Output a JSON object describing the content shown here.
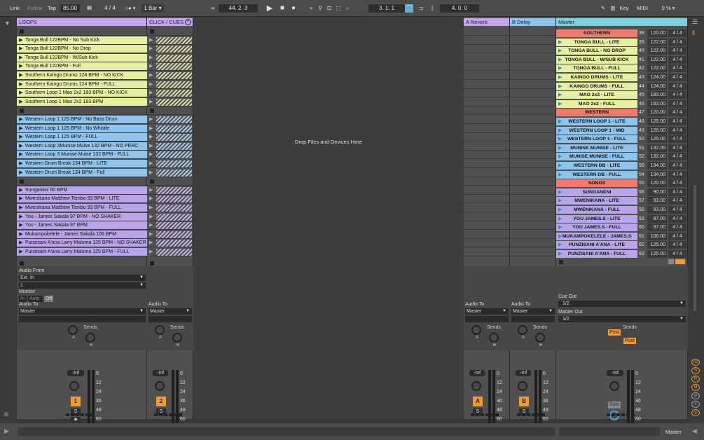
{
  "topbar": {
    "link": "Link",
    "follow": "Follow",
    "tap": "Tap",
    "tempo": "85.00",
    "signature": "4 / 4",
    "quantize": "1 Bar",
    "position": "44.  2.  3",
    "loop_start": "3.  1.  1",
    "loop_length": "4.  0.  0",
    "key": "Key",
    "midi": "MIDI",
    "cpu": "0 %"
  },
  "tracks": {
    "loops": {
      "name": "LOOPS",
      "color": "#c7a6f0",
      "clips": [
        {
          "name": "",
          "type": "stop"
        },
        {
          "name": "Tonga Bull 122BPM - No Sub Kick",
          "color": "#e6f0a0"
        },
        {
          "name": "Tonga Bull 122BPM - No Drop",
          "color": "#e6f0a0"
        },
        {
          "name": "Tonga Bull 122BPM - W/Sub Kick",
          "color": "#e6f0a0"
        },
        {
          "name": "Tonga Bull 122BPM - Full",
          "color": "#e6f0a0"
        },
        {
          "name": "Southern Kaingo Drums 124 BPM - NO KICK",
          "color": "#e6f0a0"
        },
        {
          "name": "Southern Kaingo Drums 124 BPM - FULL",
          "color": "#e6f0a0"
        },
        {
          "name": "Southern Loop 1 Mao 2x2 183 BPM - NO KICK",
          "color": "#e6f0a0"
        },
        {
          "name": "Southern Loop 1 Mao 2x2 183 BPM",
          "color": "#e6f0a0"
        },
        {
          "name": "",
          "type": "stop"
        },
        {
          "name": "Western Loop 1 125 BPM -  No Bass Drum",
          "color": "#8ec4ee"
        },
        {
          "name": "Western Loop 1 125 BPM -  No Whistle",
          "color": "#8ec4ee"
        },
        {
          "name": "Western Loop 1 125 BPM - FULL",
          "color": "#8ec4ee"
        },
        {
          "name": "Western Loop 3Munise Muise 132 BPM - NO PERC",
          "color": "#8ec4ee"
        },
        {
          "name": "Western Loop 3 Munise Muise 132 BPM - FULL",
          "color": "#8ec4ee"
        },
        {
          "name": "Western Drum Break 134 BPM - LITE",
          "color": "#8ec4ee"
        },
        {
          "name": "Western Drum Break 134 BPM - Full",
          "color": "#8ec4ee"
        },
        {
          "name": "",
          "type": "stop"
        },
        {
          "name": "Sunganeni 90 BPM",
          "color": "#b8a4ea"
        },
        {
          "name": "Mwenikana Matthew Tembo 93 BPM - LITE",
          "color": "#b8a4ea"
        },
        {
          "name": "Mwenikana Matthew Tembo 93 BPM - FULL",
          "color": "#b8a4ea"
        },
        {
          "name": "You - James Sakala 97 BPM - NO SHAKER",
          "color": "#b8a4ea"
        },
        {
          "name": "You - James Sakala 97 BPM",
          "color": "#b8a4ea"
        },
        {
          "name": "Mukampokelele - James Sakala 106 BPM",
          "color": "#b8a4ea"
        },
        {
          "name": "Punzisani A'ana Larry Maluma 125 BPM - NO SHAKER",
          "color": "#b8a4ea"
        },
        {
          "name": "Punzisani A'ana Larry Maluma 125 BPM - FULL",
          "color": "#b8a4ea"
        }
      ],
      "audio_from_label": "Audio From",
      "audio_from": "Ext. In",
      "audio_from_channel": "1",
      "monitor_label": "Monitor",
      "monitor_in": "In",
      "monitor_auto": "Auto",
      "monitor_off": "Off",
      "audio_to_label": "Audio To",
      "audio_to": "Master",
      "sends_label": "Sends",
      "volume": "-Inf",
      "number": "1",
      "solo": "S"
    },
    "click": {
      "name": "CLICK / CUES",
      "color": "#c7a6f0",
      "audio_to_label": "Audio To",
      "audio_to": "Master",
      "sends_label": "Sends",
      "volume": "-Inf",
      "number": "2",
      "solo": "S"
    },
    "reverb": {
      "name": "A Reverb",
      "color": "#c7a6f0",
      "audio_to_label": "Audio To",
      "audio_to": "Master",
      "sends_label": "Sends",
      "volume": "-Inf",
      "letter": "A",
      "solo": "S"
    },
    "delay": {
      "name": "B Delay",
      "color": "#8ec4ee",
      "audio_to_label": "Audio To",
      "audio_to": "Master",
      "sends_label": "Sends",
      "volume": "-Inf",
      "letter": "B",
      "solo": "S"
    },
    "master": {
      "name": "Master",
      "color": "#7fd0e0",
      "scenes": [
        {
          "name": "SOUTHERN",
          "num": "38",
          "bpm": "120.00",
          "sig": "4 / 4",
          "color": "#f07a6c",
          "play": false
        },
        {
          "name": "TONGA BULL - LITE",
          "num": "39",
          "bpm": "122.00",
          "sig": "4 / 4",
          "color": "#e6f0a0",
          "play": true
        },
        {
          "name": "TONGA BULL - NO DROP",
          "num": "40",
          "bpm": "122.00",
          "sig": "4 / 4",
          "color": "#e6f0a0",
          "play": true
        },
        {
          "name": "TONGA BULL - W/SUB KICK",
          "num": "41",
          "bpm": "122.00",
          "sig": "4 / 4",
          "color": "#e6f0a0",
          "play": true
        },
        {
          "name": "TONGA BULL - FULL",
          "num": "42",
          "bpm": "122.00",
          "sig": "4 / 4",
          "color": "#e6f0a0",
          "play": true
        },
        {
          "name": "KAINGO DRUMS - LITE",
          "num": "43",
          "bpm": "124.00",
          "sig": "4 / 4",
          "color": "#e6f0a0",
          "play": true
        },
        {
          "name": "KAINGO DRUMS - FULL",
          "num": "44",
          "bpm": "124.00",
          "sig": "4 / 4",
          "color": "#e6f0a0",
          "play": true
        },
        {
          "name": "MAO 2x2 - LITE",
          "num": "45",
          "bpm": "183.00",
          "sig": "4 / 4",
          "color": "#e6f0a0",
          "play": true
        },
        {
          "name": "MAO 2x2 - FULL",
          "num": "46",
          "bpm": "183.00",
          "sig": "4 / 4",
          "color": "#e6f0a0",
          "play": true
        },
        {
          "name": "WESTERN",
          "num": "47",
          "bpm": "120.00",
          "sig": "4 / 4",
          "color": "#f07a6c",
          "play": false
        },
        {
          "name": "WESTERN LOOP 1 - LITE",
          "num": "48",
          "bpm": "125.00",
          "sig": "4 / 4",
          "color": "#8ec4ee",
          "play": true
        },
        {
          "name": "WESTERN LOOP 1 - MID",
          "num": "49",
          "bpm": "125.00",
          "sig": "4 / 4",
          "color": "#8ec4ee",
          "play": true
        },
        {
          "name": "WESTERN LOOP 1 - FULL",
          "num": "50",
          "bpm": "125.00",
          "sig": "4 / 4",
          "color": "#8ec4ee",
          "play": true
        },
        {
          "name": "MUNISE MUNISE - LITE",
          "num": "51",
          "bpm": "132.00",
          "sig": "4 / 4",
          "color": "#8ec4ee",
          "play": true
        },
        {
          "name": "MUNISE MUNISE - FULL",
          "num": "52",
          "bpm": "132.00",
          "sig": "4 / 4",
          "color": "#8ec4ee",
          "play": true
        },
        {
          "name": "WESTERN DB - LITE",
          "num": "53",
          "bpm": "134.00",
          "sig": "4 / 4",
          "color": "#8ec4ee",
          "play": true
        },
        {
          "name": "WESTERN DB - FULL",
          "num": "54",
          "bpm": "134.00",
          "sig": "4 / 4",
          "color": "#8ec4ee",
          "play": true
        },
        {
          "name": "SONGS",
          "num": "55",
          "bpm": "120.00",
          "sig": "4 / 4",
          "color": "#f07a6c",
          "play": false
        },
        {
          "name": "SUNGANENI",
          "num": "56",
          "bpm": "90.00",
          "sig": "4 / 4",
          "color": "#b8a4ea",
          "play": true
        },
        {
          "name": "MWENIKANA - LITE",
          "num": "57",
          "bpm": "93.00",
          "sig": "4 / 4",
          "color": "#b8a4ea",
          "play": true
        },
        {
          "name": "MWENIKANA - FULL",
          "num": "58",
          "bpm": "93.00",
          "sig": "4 / 4",
          "color": "#b8a4ea",
          "play": true
        },
        {
          "name": "YOU JAMES.S - LITE",
          "num": "59",
          "bpm": "97.00",
          "sig": "4 / 4",
          "color": "#b8a4ea",
          "play": true
        },
        {
          "name": "YOU JAMES.S - FULL",
          "num": "60",
          "bpm": "97.00",
          "sig": "4 / 4",
          "color": "#b8a4ea",
          "play": true
        },
        {
          "name": "MUKAMPOKELELE - JAMES.S",
          "num": "61",
          "bpm": "106.00",
          "sig": "4 / 4",
          "color": "#b8a4ea",
          "play": true
        },
        {
          "name": "PUNZISANI A'ANA - LITE",
          "num": "62",
          "bpm": "125.00",
          "sig": "4 / 4",
          "color": "#b8a4ea",
          "play": true
        },
        {
          "name": "PUNZISANI A'ANA - FULL",
          "num": "63",
          "bpm": "125.00",
          "sig": "4 / 4",
          "color": "#b8a4ea",
          "play": true
        }
      ],
      "cue_out_label": "Cue Out",
      "cue_out": "1/2",
      "master_out_label": "Master Out",
      "master_out": "1/2",
      "sends_label": "Sends",
      "post1": "Post",
      "post2": "Post",
      "volume": "-Inf",
      "solo": "Solo"
    }
  },
  "db_scale": [
    "0",
    "12",
    "24",
    "36",
    "48",
    "60"
  ],
  "drop_hint": "Drop Files and Devices Here",
  "bottom": {
    "status": "",
    "master_label": "Master"
  }
}
